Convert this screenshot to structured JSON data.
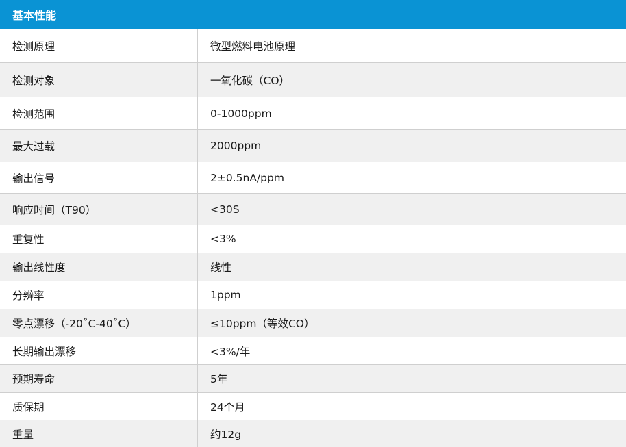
{
  "header": {
    "title": "基本性能"
  },
  "rows": [
    {
      "label": "检测原理",
      "value": "微型燃料电池原理"
    },
    {
      "label": "检测对象",
      "value": "一氧化碳（CO）"
    },
    {
      "label": "检测范围",
      "value": "0-1000ppm"
    },
    {
      "label": "最大过载",
      "value": "2000ppm"
    },
    {
      "label": "输出信号",
      "value": "2±0.5nA/ppm"
    },
    {
      "label": "响应时间（T90）",
      "value": "<30S"
    },
    {
      "label": "重复性",
      "value": "<3%"
    },
    {
      "label": "输出线性度",
      "value": "线性"
    },
    {
      "label": "分辨率",
      "value": "1ppm"
    },
    {
      "label": "零点漂移（-20˚C-40˚C）",
      "value": "≤10ppm（等效CO）"
    },
    {
      "label": "长期输出漂移",
      "value": "<3%/年"
    },
    {
      "label": "预期寿命",
      "value": "5年"
    },
    {
      "label": "质保期",
      "value": "24个月"
    },
    {
      "label": "重量",
      "value": "约12g"
    }
  ]
}
